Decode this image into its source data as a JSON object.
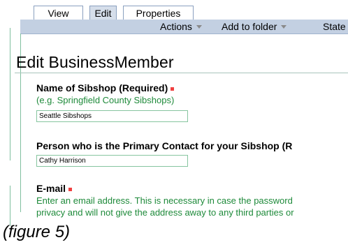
{
  "tabs": [
    {
      "label": "View"
    },
    {
      "label": "Edit"
    },
    {
      "label": "Properties"
    }
  ],
  "actions": {
    "actions_label": "Actions",
    "add_to_folder_label": "Add to folder",
    "state_label": "State"
  },
  "page": {
    "title": "Edit BusinessMember"
  },
  "fields": {
    "name": {
      "label": "Name of Sibshop (Required)",
      "hint": "(e.g. Springfield County Sibshops)",
      "value": "Seattle Sibshops"
    },
    "contact": {
      "label": "Person who is the Primary Contact for your Sibshop (R",
      "value": "Cathy Harrison"
    },
    "email": {
      "label": "E-mail",
      "hint_line1": "Enter an email address. This is necessary in case the password",
      "hint_line2": "privacy and will not give the address away to any third parties or"
    }
  },
  "caption": "(figure 5)",
  "colors": {
    "accent_bar": "#c3d0e2",
    "hint_green": "#1e8a3a",
    "required_red": "#f04040",
    "field_border": "#86c59f"
  }
}
